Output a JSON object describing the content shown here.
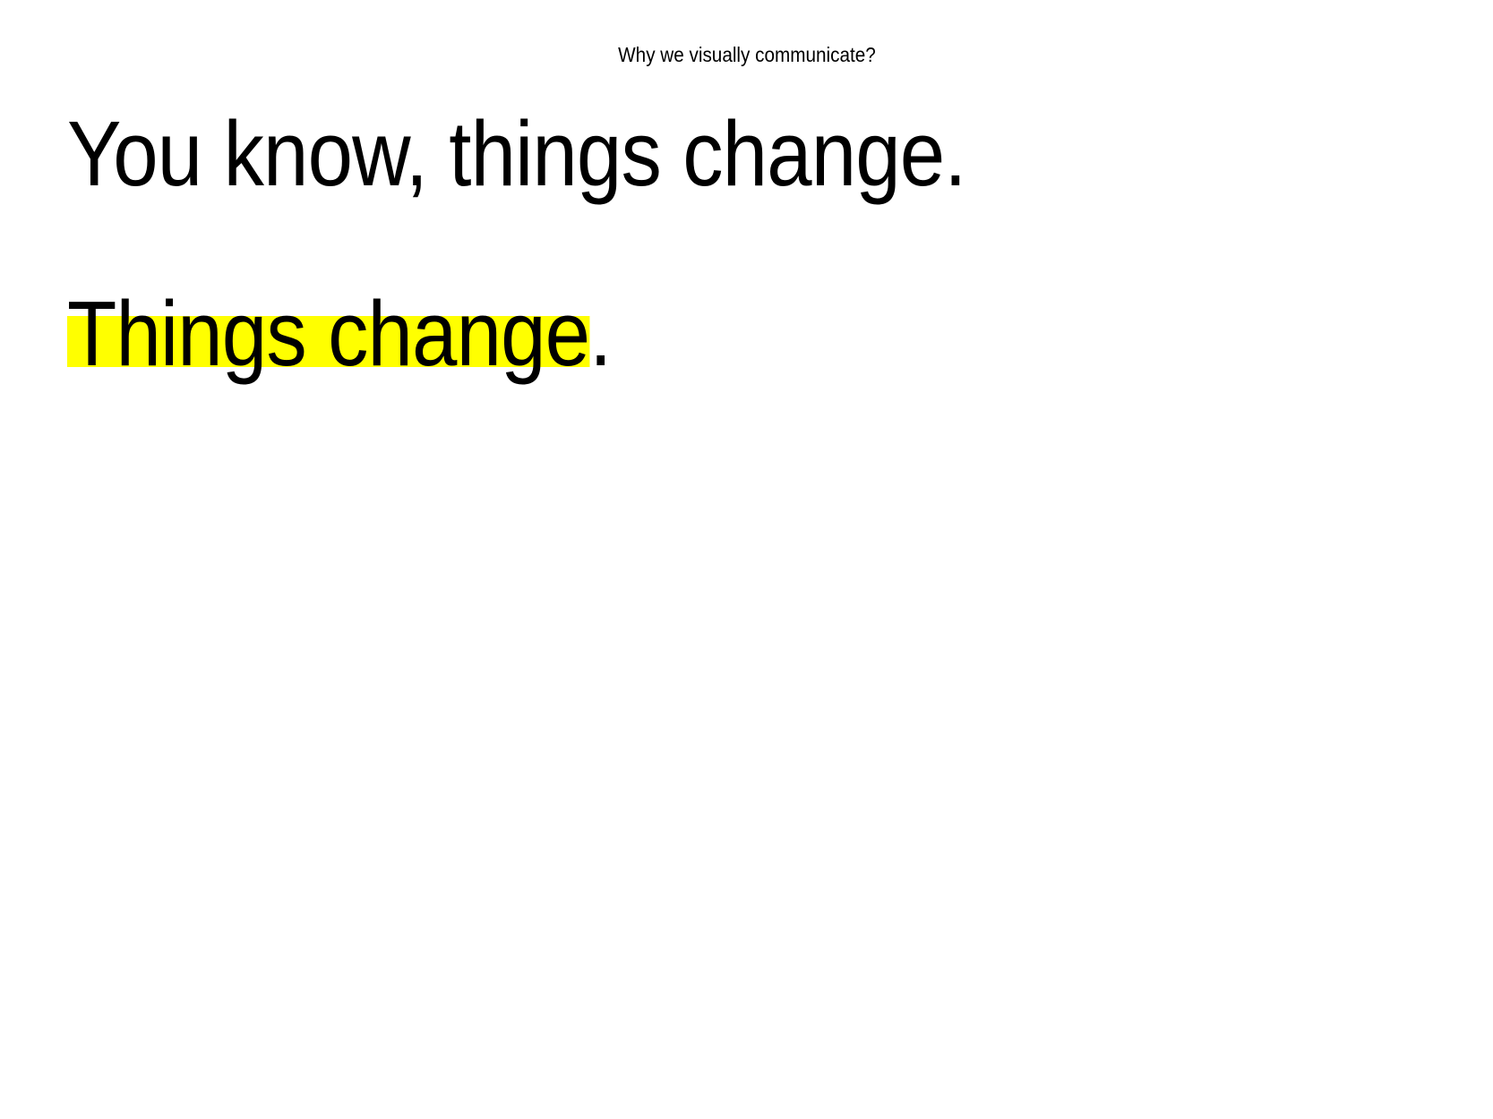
{
  "header": {
    "title": "Why we visually communicate?"
  },
  "main": {
    "headline": "You know, things change.",
    "statement": {
      "highlighted": "Things change",
      "rest": "."
    }
  },
  "colors": {
    "highlight": "#ffff00",
    "text": "#000000",
    "background": "#ffffff"
  }
}
